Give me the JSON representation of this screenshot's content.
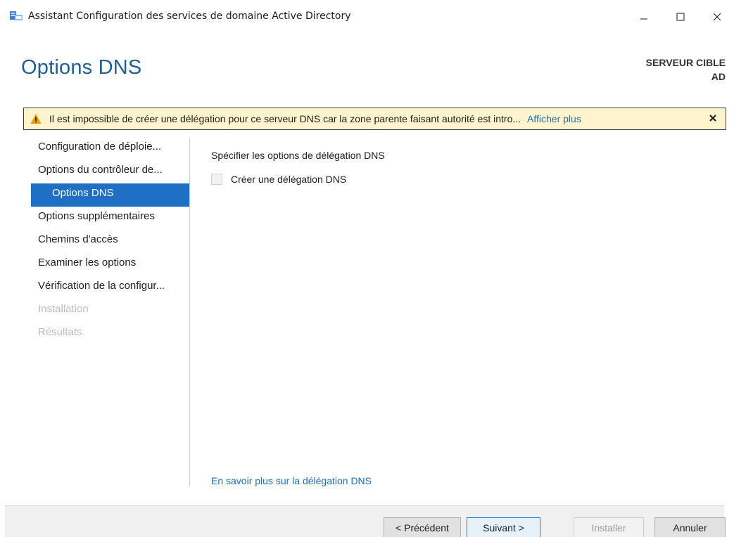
{
  "window": {
    "title": "Assistant Configuration des services de domaine Active Directory",
    "icon": "ad-wizard-icon",
    "controls": {
      "minimize": "—",
      "maximize": "☐",
      "close": "✕"
    }
  },
  "header": {
    "page_title": "Options DNS",
    "target_label": "SERVEUR CIBLE",
    "target_name": "AD"
  },
  "warning": {
    "icon": "warning-icon",
    "text": "Il est impossible de créer une délégation pour ce serveur DNS car la zone parente faisant autorité est intro...",
    "link": "Afficher plus",
    "close_icon": "close-icon"
  },
  "nav": {
    "items": [
      {
        "label": "Configuration de déploie...",
        "state": "normal"
      },
      {
        "label": "Options du contrôleur de...",
        "state": "normal"
      },
      {
        "label": "Options DNS",
        "state": "active"
      },
      {
        "label": "Options supplémentaires",
        "state": "normal"
      },
      {
        "label": "Chemins d'accès",
        "state": "normal"
      },
      {
        "label": "Examiner les options",
        "state": "normal"
      },
      {
        "label": "Vérification de la configur...",
        "state": "normal"
      },
      {
        "label": "Installation",
        "state": "disabled"
      },
      {
        "label": "Résultats",
        "state": "disabled"
      }
    ]
  },
  "main": {
    "section_title": "Spécifier les options de délégation DNS",
    "checkbox_label": "Créer une délégation DNS",
    "checkbox_checked": false,
    "learn_more_link": "En savoir plus sur la délégation DNS"
  },
  "footer": {
    "prev_label": "< Précédent",
    "next_label": "Suivant >",
    "install_label": "Installer",
    "cancel_label": "Annuler"
  },
  "colors": {
    "accent": "#1f6fc5",
    "title": "#1f5f96",
    "link": "#1f6ebd",
    "warning_bg": "#fff4ce",
    "warning_icon": "#e8a000"
  }
}
